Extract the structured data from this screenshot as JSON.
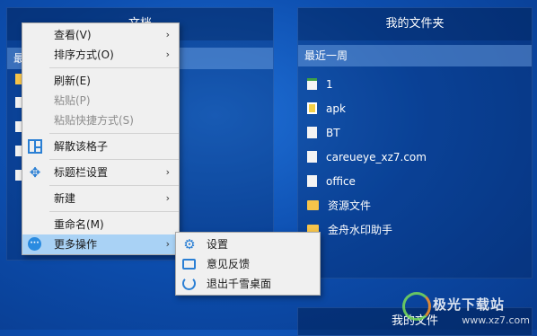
{
  "left_panel": {
    "title": "文档",
    "section": "最"
  },
  "folder_panel": {
    "title": "我的文件夹",
    "section": "最近一周",
    "items": [
      {
        "name": "1",
        "icon": "image-file-icon"
      },
      {
        "name": "apk",
        "icon": "apk-file-icon"
      },
      {
        "name": "BT",
        "icon": "document-file-icon"
      },
      {
        "name": "careueye_xz7.com",
        "icon": "document-file-icon"
      },
      {
        "name": "office",
        "icon": "document-file-icon"
      },
      {
        "name": "资源文件",
        "icon": "folder-icon"
      },
      {
        "name": "金舟水印助手",
        "icon": "folder-icon"
      }
    ]
  },
  "bottom_panel": {
    "title": "我的文件"
  },
  "context_menu": {
    "view": "查看(V)",
    "sort": "排序方式(O)",
    "refresh": "刷新(E)",
    "paste": "粘贴(P)",
    "paste_shortcut": "粘贴快捷方式(S)",
    "dissolve": "解散该格子",
    "titlebar": "标题栏设置",
    "new": "新建",
    "rename": "重命名(M)",
    "more": "更多操作"
  },
  "submenu": {
    "settings": "设置",
    "feedback": "意见反馈",
    "exit": "退出千雪桌面"
  },
  "watermark": {
    "text": "极光下载站",
    "url": "www.xz7.com"
  },
  "colors": {
    "menu_highlight": "#a9d2f5",
    "icon_blue": "#2a7fd4"
  }
}
